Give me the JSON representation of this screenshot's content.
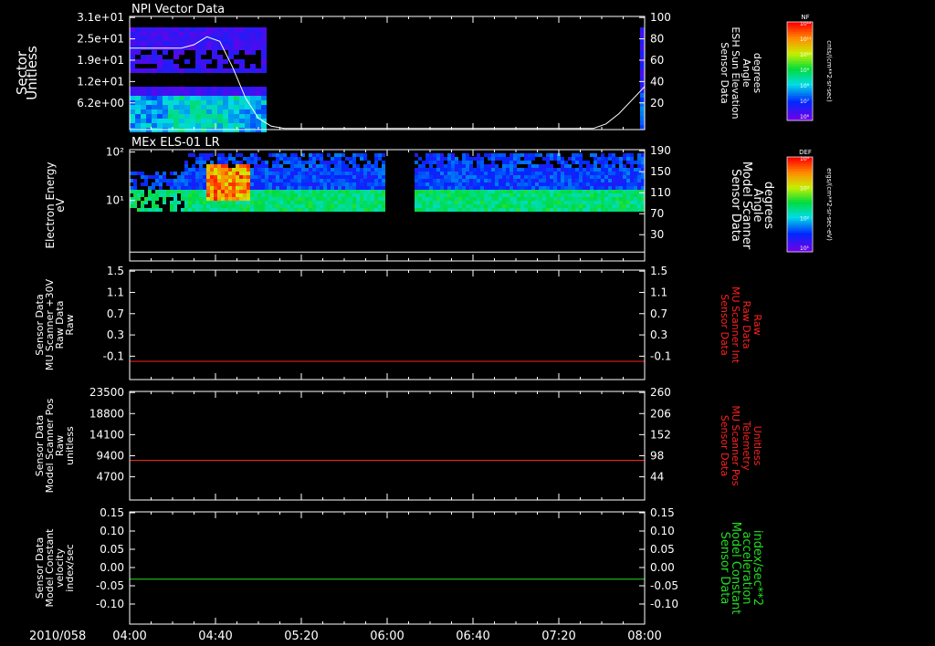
{
  "colors": {
    "background": "#000000",
    "axis": "#ffffff",
    "red": "#ff2020",
    "green": "#22dd22"
  },
  "time_axis": {
    "date_label": "2010/058",
    "ticks": [
      "04:00",
      "04:40",
      "05:20",
      "06:00",
      "06:40",
      "07:20",
      "08:00"
    ]
  },
  "chart_data": [
    {
      "type": "heatmap",
      "title": "NPI Vector Data",
      "ylabel": "Sector",
      "yunit": "Unitless",
      "yticks": [
        "3.1e+01",
        "2.5e+01",
        "1.9e+01",
        "1.2e+01",
        "6.2e+00"
      ],
      "right_axis": {
        "label": [
          "Sensor Data",
          "ESH Sun Elevation",
          "Angle",
          "degrees"
        ],
        "ylim": [
          0,
          100
        ],
        "ticks": [
          "100",
          "80",
          "60",
          "40",
          "20"
        ]
      },
      "colorbar": {
        "name": "NF",
        "unit": "cnts/(cm**2-sr-sec)",
        "ticks": [
          "10¹²",
          "10¹¹",
          "10¹⁰",
          "10⁹",
          "10⁸",
          "10⁷",
          "10⁶"
        ]
      },
      "overlay_line": {
        "x_hours": [
          4.0,
          4.1,
          4.2,
          4.3,
          4.4,
          4.5,
          4.6,
          4.7,
          4.8,
          4.9,
          5.0,
          5.1,
          5.2,
          5.3,
          5.4,
          5.5,
          6.0,
          6.5,
          7.0,
          7.5,
          7.6,
          7.7,
          7.8,
          7.9,
          8.0
        ],
        "y_degrees": [
          72,
          72,
          72,
          72,
          72,
          75,
          82,
          78,
          55,
          28,
          10,
          3,
          1,
          1,
          1,
          1,
          1,
          1,
          1,
          1,
          1,
          5,
          14,
          26,
          38
        ]
      }
    },
    {
      "type": "heatmap",
      "title": "MEx ELS-01 LR",
      "ylabel": "Electron Energy",
      "yunit": "eV",
      "yticks": [
        "10²",
        "10¹"
      ],
      "right_axis": {
        "label": [
          "Sensor Data",
          "Model Scanner",
          "Angle",
          "degrees"
        ],
        "ylim": [
          -10,
          190
        ],
        "ticks": [
          "190",
          "150",
          "110",
          "70",
          "30"
        ]
      },
      "colorbar": {
        "name": "DEF",
        "unit": "ergs/(cm**2-sr-sec-eV)",
        "ticks": [
          "10⁴",
          "10³",
          "10²",
          "10¹"
        ]
      },
      "overlay_line": {
        "x_hours": [
          4.0,
          8.0
        ],
        "y_degrees": [
          6,
          6
        ]
      }
    },
    {
      "type": "line",
      "ylabel": [
        "Sensor Data",
        "MU Scanner +30V",
        "Raw Data",
        "Raw"
      ],
      "ylim": [
        -0.3,
        1.5
      ],
      "yticks": [
        "1.5",
        "1.1",
        "0.7",
        "0.3",
        "-0.1"
      ],
      "right_axis": {
        "label": [
          "Sensor Data",
          "MU Scanner Int",
          "Raw Data",
          "Raw"
        ],
        "ylim": [
          -0.3,
          1.5
        ],
        "ticks": [
          "1.5",
          "1.1",
          "0.7",
          "0.3",
          "-0.1"
        ]
      },
      "series": [
        {
          "x_hours": [
            4.0,
            8.0
          ],
          "values": [
            0.0,
            0.0
          ],
          "color": "#ff2020"
        }
      ]
    },
    {
      "type": "line",
      "ylabel": [
        "Sensor Data",
        "Model Scanner Pos",
        "Raw",
        "unitless"
      ],
      "ylim": [
        0,
        23500
      ],
      "yticks": [
        "23500",
        "18800",
        "14100",
        "9400",
        "4700"
      ],
      "right_axis": {
        "label": [
          "Sensor Data",
          "MU Scanner Pos",
          "Telemetry",
          "Unitless"
        ],
        "ylim": [
          -10,
          260
        ],
        "ticks": [
          "260",
          "206",
          "152",
          "98",
          "44"
        ]
      },
      "series": [
        {
          "x_hours": [
            4.0,
            8.0
          ],
          "values": [
            8600,
            8600
          ],
          "color": "#ff2020"
        }
      ]
    },
    {
      "type": "line",
      "ylabel": [
        "Sensor Data",
        "Model Constant",
        "velocity",
        "index/sec"
      ],
      "ylim": [
        -0.1,
        0.15
      ],
      "yticks": [
        "0.15",
        "0.10",
        "0.05",
        "0.00",
        "-0.05",
        "-0.10"
      ],
      "right_axis": {
        "label": [
          "Sensor Data",
          "Model Constant",
          "acceleration",
          "index/sec**2"
        ],
        "ylim": [
          -0.1,
          0.15
        ],
        "ticks": [
          "0.15",
          "0.10",
          "0.05",
          "0.00",
          "-0.05",
          "-0.10"
        ]
      },
      "series": [
        {
          "x_hours": [
            4.0,
            8.0
          ],
          "values": [
            0.0,
            0.0
          ],
          "color": "#22dd22"
        }
      ]
    }
  ]
}
